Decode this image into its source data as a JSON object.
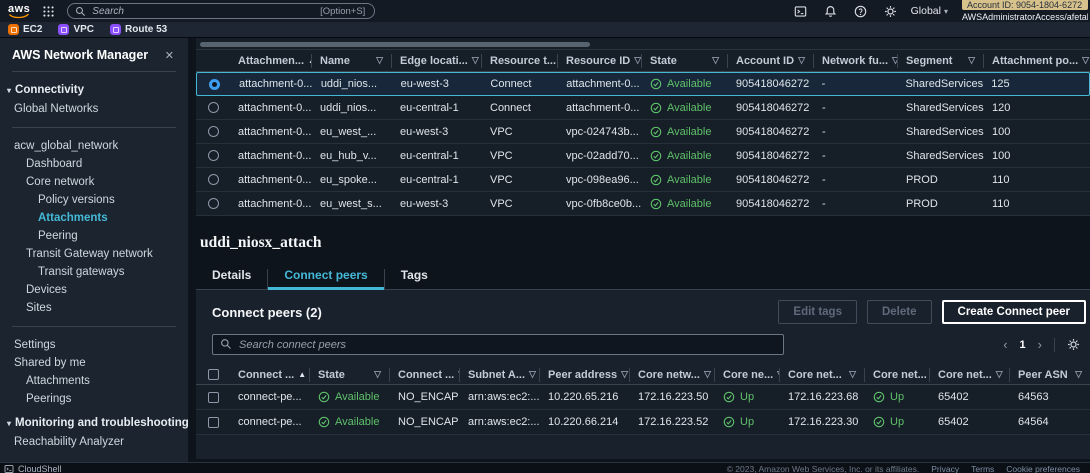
{
  "topbar": {
    "logo": "aws",
    "search_placeholder": "Search",
    "search_shortcut": "[Option+S]",
    "region": "Global",
    "account_id": "Account ID: 9054-1804-6272",
    "account_role": "AWSAdministratorAccess/afetah"
  },
  "favorites": {
    "items": [
      {
        "label": "EC2",
        "color": "#ED7100"
      },
      {
        "label": "VPC",
        "color": "#8C4FFF"
      },
      {
        "label": "Route 53",
        "color": "#8C4FFF"
      }
    ]
  },
  "sidebar": {
    "title": "AWS Network Manager",
    "items": [
      {
        "label": "Connectivity"
      },
      {
        "label": "Global Networks"
      },
      {
        "label": "acw_global_network"
      },
      {
        "label": "Dashboard"
      },
      {
        "label": "Core network"
      },
      {
        "label": "Policy versions"
      },
      {
        "label": "Attachments"
      },
      {
        "label": "Peering"
      },
      {
        "label": "Transit Gateway network"
      },
      {
        "label": "Transit gateways"
      },
      {
        "label": "Devices"
      },
      {
        "label": "Sites"
      },
      {
        "label": "Settings"
      },
      {
        "label": "Shared by me"
      },
      {
        "label": "Attachments"
      },
      {
        "label": "Peerings"
      },
      {
        "label": "Monitoring and troubleshooting"
      },
      {
        "label": "Reachability Analyzer"
      }
    ]
  },
  "attachments": {
    "columns": [
      "Attachmen...",
      "Name",
      "Edge locati...",
      "Resource t...",
      "Resource ID",
      "State",
      "Account ID",
      "Network fu...",
      "Segment",
      "Attachment po..."
    ],
    "rows": [
      [
        "attachment-0...",
        "uddi_nios...",
        "eu-west-3",
        "Connect",
        "attachment-0...",
        "Available",
        "905418046272",
        "-",
        "SharedServices",
        "125"
      ],
      [
        "attachment-0...",
        "uddi_nios...",
        "eu-central-1",
        "Connect",
        "attachment-0...",
        "Available",
        "905418046272",
        "-",
        "SharedServices",
        "120"
      ],
      [
        "attachment-0...",
        "eu_west_...",
        "eu-west-3",
        "VPC",
        "vpc-024743b...",
        "Available",
        "905418046272",
        "-",
        "SharedServices",
        "100"
      ],
      [
        "attachment-0...",
        "eu_hub_v...",
        "eu-central-1",
        "VPC",
        "vpc-02add70...",
        "Available",
        "905418046272",
        "-",
        "SharedServices",
        "100"
      ],
      [
        "attachment-0...",
        "eu_spoke...",
        "eu-central-1",
        "VPC",
        "vpc-098ea96...",
        "Available",
        "905418046272",
        "-",
        "PROD",
        "110"
      ],
      [
        "attachment-0...",
        "eu_west_s...",
        "eu-west-3",
        "VPC",
        "vpc-0fb8ce0b...",
        "Available",
        "905418046272",
        "-",
        "PROD",
        "110"
      ]
    ]
  },
  "detail": {
    "heading": "uddi_niosx_attach",
    "tabs": [
      "Details",
      "Connect peers",
      "Tags"
    ]
  },
  "connect_peers": {
    "title": "Connect peers (2)",
    "edit_tags_label": "Edit tags",
    "delete_label": "Delete",
    "create_label": "Create Connect peer",
    "search_placeholder": "Search connect peers",
    "page": "1",
    "columns": [
      "Connect ...",
      "State",
      "Connect ...",
      "Subnet A...",
      "Peer address",
      "Core netw...",
      "Core ne...",
      "Core net...",
      "Core net...",
      "Core net...",
      "Peer ASN"
    ],
    "rows": [
      [
        "connect-pe...",
        "Available",
        "NO_ENCAP",
        "arn:aws:ec2:...",
        "10.220.65.216",
        "172.16.223.50",
        "Up",
        "172.16.223.68",
        "Up",
        "65402",
        "64563"
      ],
      [
        "connect-pe...",
        "Available",
        "NO_ENCAP",
        "arn:aws:ec2:...",
        "10.220.66.214",
        "172.16.223.52",
        "Up",
        "172.16.223.30",
        "Up",
        "65402",
        "64564"
      ]
    ]
  },
  "footer": {
    "cloudshell": "CloudShell",
    "copyright": "© 2023, Amazon Web Services, Inc. or its affiliates.",
    "links": [
      "Privacy",
      "Terms",
      "Cookie preferences"
    ]
  },
  "colors": {
    "accent": "#44b9d6",
    "success": "#5fc16a",
    "selected_border": "#44b9d6"
  }
}
